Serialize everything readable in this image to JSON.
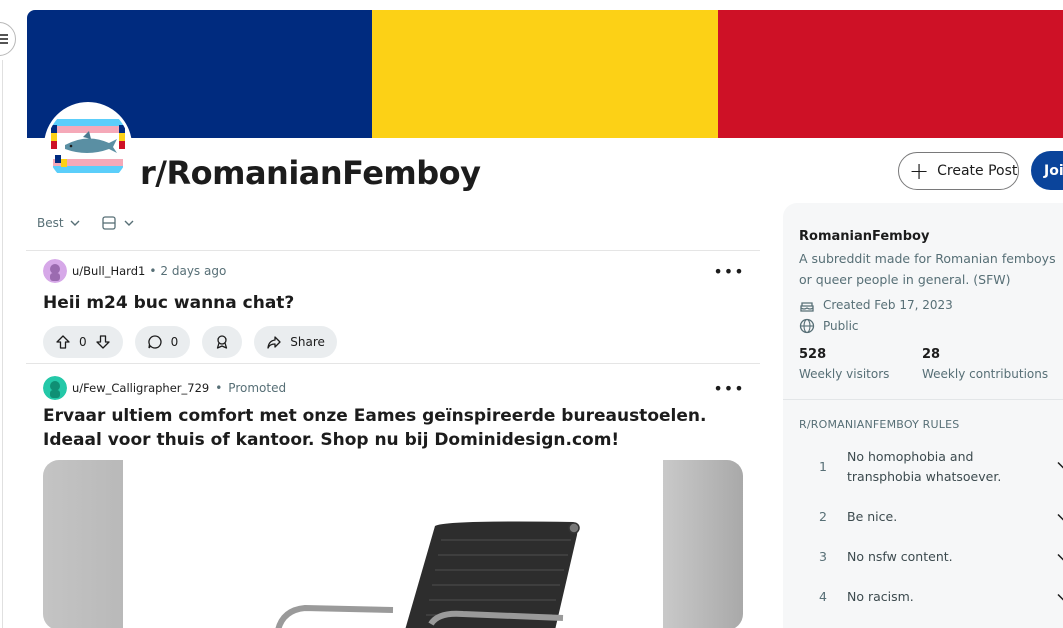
{
  "subreddit": {
    "title": "r/RomanianFemboy",
    "flag_colors": [
      "#002b7f",
      "#fcd116",
      "#ce1126"
    ]
  },
  "header": {
    "create_post_label": "Create Post",
    "join_label": "Join"
  },
  "sort": {
    "selected": "Best"
  },
  "posts": [
    {
      "author": "u/Bull_Hard1",
      "time": "2 days ago",
      "title": "Heii m24 buc wanna chat?",
      "score": "0",
      "comments": "0",
      "share_label": "Share"
    },
    {
      "author": "u/Few_Calligrapher_729",
      "tag": "Promoted",
      "title": "Ervaar ultiem comfort met onze Eames geïnspireerde bureaustoelen. Ideaal voor thuis of kantoor. Shop nu bij Dominidesign.com!"
    }
  ],
  "sidebar": {
    "name": "RomanianFemboy",
    "description": "A subreddit made for Romanian femboys or queer people in general. (SFW)",
    "created": "Created Feb 17, 2023",
    "visibility": "Public",
    "visitors_count": "528",
    "visitors_label": "Weekly visitors",
    "contributions_count": "28",
    "contributions_label": "Weekly contributions",
    "rules_heading": "R/ROMANIANFEMBOY RULES",
    "rules": [
      {
        "num": "1",
        "text": "No homophobia and transphobia whatsoever."
      },
      {
        "num": "2",
        "text": "Be nice."
      },
      {
        "num": "3",
        "text": "No nsfw content."
      },
      {
        "num": "4",
        "text": "No racism."
      }
    ]
  }
}
